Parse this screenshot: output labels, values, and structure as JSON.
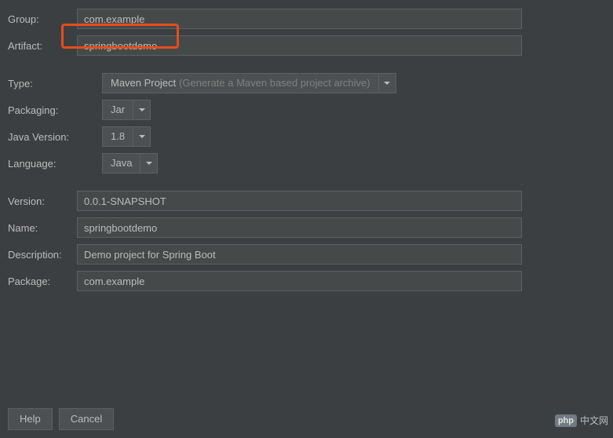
{
  "form": {
    "group": {
      "label": "Group:",
      "value": "com.example"
    },
    "artifact": {
      "label": "Artifact:",
      "value": "springbootdemo"
    },
    "type": {
      "label": "Type:",
      "value": "Maven Project",
      "hint": "(Generate a Maven based project archive)"
    },
    "packaging": {
      "label": "Packaging:",
      "value": "Jar"
    },
    "javaVersion": {
      "label": "Java Version:",
      "value": "1.8"
    },
    "language": {
      "label": "Language:",
      "value": "Java"
    },
    "version": {
      "label": "Version:",
      "value": "0.0.1-SNAPSHOT"
    },
    "name": {
      "label": "Name:",
      "value": "springbootdemo"
    },
    "description": {
      "label": "Description:",
      "value": "Demo project for Spring Boot"
    },
    "package": {
      "label": "Package:",
      "value": "com.example"
    }
  },
  "footer": {
    "help": "Help",
    "cancel": "Cancel"
  },
  "watermark": {
    "badge": "php",
    "text": "中文网"
  }
}
